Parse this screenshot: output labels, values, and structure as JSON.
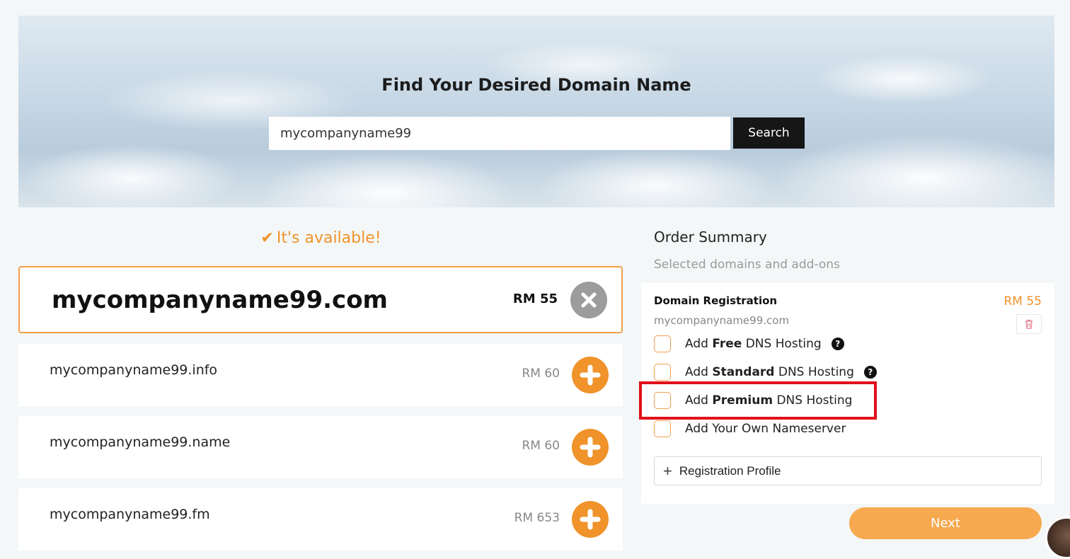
{
  "hero": {
    "title": "Find Your Desired Domain Name",
    "search_value": "mycompanyname99",
    "search_button": "Search"
  },
  "results": {
    "status_text": "It's available!",
    "selected": {
      "domain": "mycompanyname99.com",
      "price": "RM 55"
    },
    "options": [
      {
        "domain": "mycompanyname99.info",
        "price": "RM 60"
      },
      {
        "domain": "mycompanyname99.name",
        "price": "RM 60"
      },
      {
        "domain": "mycompanyname99.fm",
        "price": "RM 653"
      }
    ]
  },
  "summary": {
    "title": "Order Summary",
    "subtitle": "Selected domains and add-ons",
    "registration": {
      "label": "Domain Registration",
      "price": "RM 55",
      "domain": "mycompanyname99.com"
    },
    "addons": [
      {
        "prefix": "Add",
        "bold": "Free",
        "suffix": "DNS Hosting",
        "checked": false
      },
      {
        "prefix": "Add",
        "bold": "Standard",
        "suffix": "DNS Hosting",
        "checked": false
      },
      {
        "prefix": "Add",
        "bold": "Premium",
        "suffix": "DNS Hosting",
        "checked": false
      },
      {
        "prefix": "Add Your Own Nameserver",
        "bold": "",
        "suffix": "",
        "checked": false
      }
    ],
    "profile_label": "Registration Profile",
    "next_label": "Next"
  },
  "colors": {
    "accent": "#f0932b",
    "highlight": "#e0101a",
    "dark_button": "#161616"
  }
}
